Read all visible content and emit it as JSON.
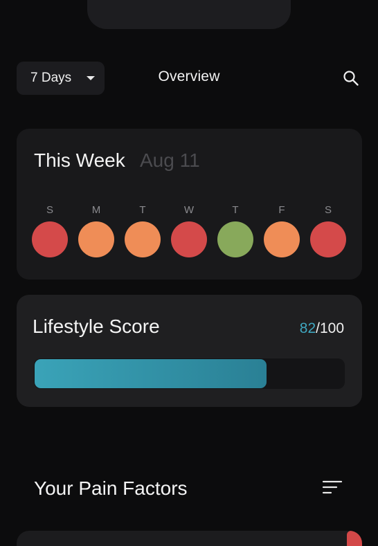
{
  "header": {
    "period_label": "7 Days",
    "title": "Overview"
  },
  "week": {
    "title": "This Week",
    "date": "Aug 11",
    "days": [
      {
        "letter": "S",
        "color": "#d44a4a"
      },
      {
        "letter": "M",
        "color": "#ef8d57"
      },
      {
        "letter": "T",
        "color": "#ef8d57"
      },
      {
        "letter": "W",
        "color": "#d44a4a"
      },
      {
        "letter": "T",
        "color": "#88a95b"
      },
      {
        "letter": "F",
        "color": "#ef8d57"
      },
      {
        "letter": "S",
        "color": "#d44a4a"
      }
    ]
  },
  "lifestyle": {
    "title": "Lifestyle Score",
    "score": "82",
    "max": "/100",
    "fraction": 0.75
  },
  "pain": {
    "title": "Your Pain Factors"
  },
  "colors": {
    "accent": "#3fa7c0",
    "background": "#0c0c0d",
    "card": "#19191b"
  },
  "icons": {
    "search": "search-icon",
    "sort": "sort-icon",
    "caret": "caret-down-icon"
  }
}
